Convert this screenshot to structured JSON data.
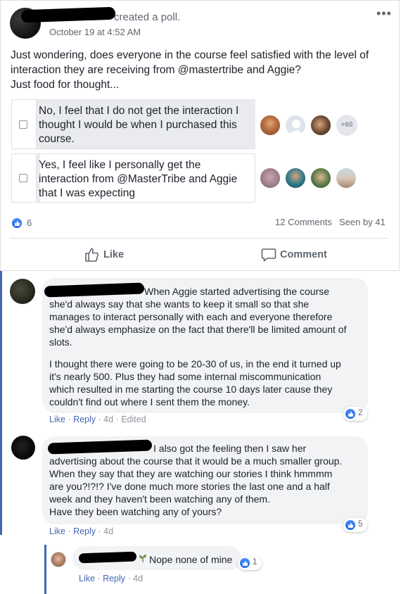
{
  "post": {
    "author_action": "created a poll.",
    "timestamp": "October 19 at 4:52 AM",
    "text_lines": [
      "Just wondering, does everyone in the course feel satisfied with the level of",
      "interaction they are receiving from @mastertribe and Aggie?",
      "Just food for thought..."
    ]
  },
  "poll": {
    "options": [
      {
        "lines": [
          "No, I feel that I do not get the interaction I",
          "thought I would be when I purchased this",
          "course."
        ],
        "extra_voters": "+60"
      },
      {
        "lines": [
          "Yes, I feel like I personally get the",
          "interaction from @MasterTribe and Aggie",
          "that I was expecting"
        ]
      }
    ]
  },
  "stats": {
    "reactions": "6",
    "comments": "12 Comments",
    "seen": "Seen by 41"
  },
  "actions": {
    "like": "Like",
    "comment": "Comment"
  },
  "comments": [
    {
      "paragraph1": [
        "When Aggie started advertising the course",
        "she'd always say that she wants to keep it small so that she",
        "manages to interact personally with each and everyone therefore",
        "she'd always emphasize on the fact that there'll be limited amount of",
        "slots."
      ],
      "paragraph2": [
        "I thought there were going to be 20-30 of us, in the end it turned up",
        "it's nearly 500. Plus they had some internal miscommunication",
        "which resulted in me starting the course 10 days later cause they",
        "couldn't find out where I sent them the money."
      ],
      "like": "Like",
      "reply": "Reply",
      "age": "4d",
      "edited": "Edited",
      "reactions": "2"
    },
    {
      "lines": [
        "I also got the feeling then I saw her",
        "advertising about the course that it would be a much smaller group.",
        "When they say that they are watching our stories I think hmmmm",
        "are you?!?!? I've done much more stories the last one and a half",
        "week and they haven't been watching any of them.",
        "Have they been watching any of yours?"
      ],
      "like": "Like",
      "reply": "Reply",
      "age": "4d",
      "reactions": "5"
    }
  ],
  "reply": {
    "text": "Nope none of mine",
    "like": "Like",
    "reply": "Reply",
    "age": "4d",
    "reactions": "1"
  },
  "colors": {
    "link": "#4267b2",
    "meta": "#606770",
    "bubble": "#f2f3f5",
    "like_blue": "#1a64e6",
    "thread_rule": "#4267b2"
  }
}
